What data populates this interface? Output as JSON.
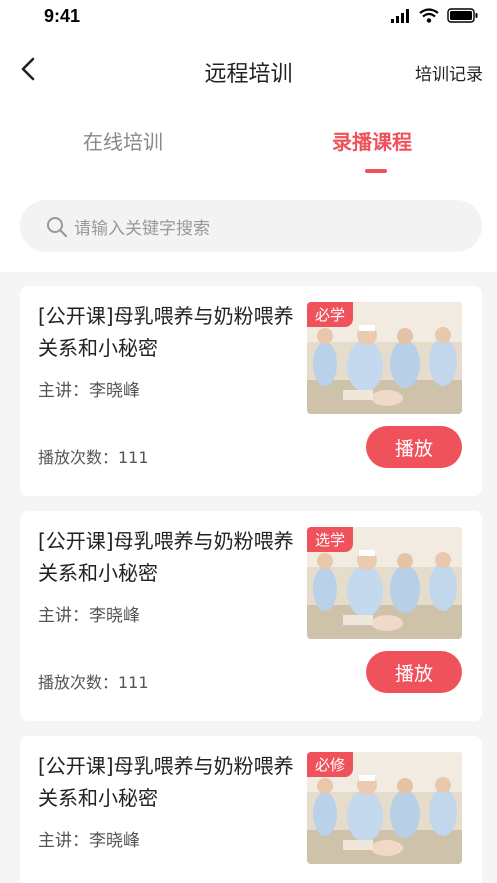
{
  "status": {
    "time": "9:41"
  },
  "nav": {
    "title": "远程培训",
    "right_link": "培训记录"
  },
  "tabs": [
    {
      "label": "在线培训",
      "active": false
    },
    {
      "label": "录播课程",
      "active": true
    }
  ],
  "search": {
    "placeholder": "请输入关键字搜索"
  },
  "courses": [
    {
      "title": "[公开课]母乳喂养与奶粉喂养关系和小秘密",
      "lecturer": "主讲：李晓峰",
      "plays": "播放次数：111",
      "badge": "必学",
      "action": "播放"
    },
    {
      "title": "[公开课]母乳喂养与奶粉喂养关系和小秘密",
      "lecturer": "主讲：李晓峰",
      "plays": "播放次数：111",
      "badge": "选学",
      "action": "播放"
    },
    {
      "title": "[公开课]母乳喂养与奶粉喂养关系和小秘密",
      "lecturer": "主讲：李晓峰",
      "plays": "",
      "badge": "必修",
      "action": ""
    }
  ],
  "colors": {
    "accent": "#f0525c",
    "background": "#f5f5f5"
  }
}
